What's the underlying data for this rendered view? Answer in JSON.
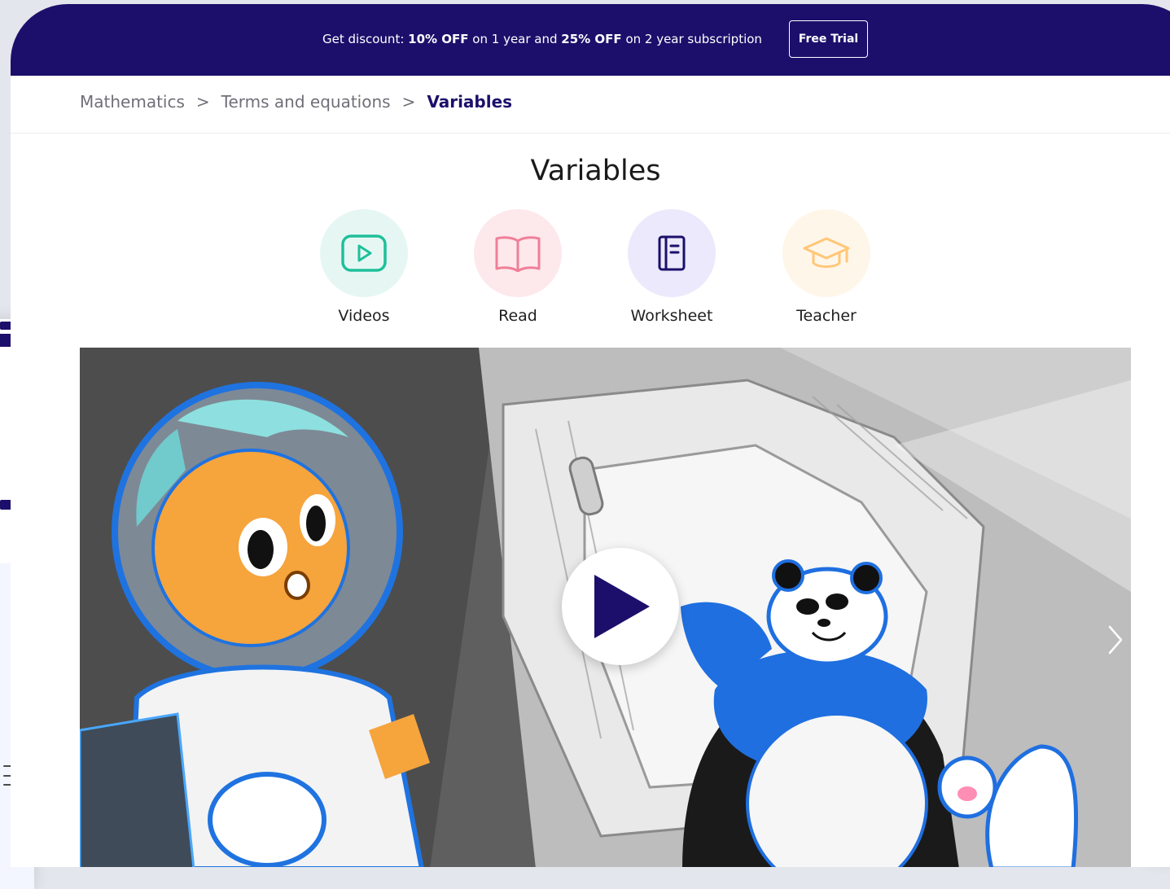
{
  "promo": {
    "prefix": "Get discount: ",
    "off1": "10% OFF",
    "mid1": " on 1 year and ",
    "off2": "25% OFF",
    "mid2": " on 2 year subscription",
    "cta": "Free Trial"
  },
  "breadcrumb": {
    "items": [
      "Mathematics",
      "Terms and equations",
      "Variables"
    ],
    "separator": ">"
  },
  "page": {
    "title": "Variables"
  },
  "tools": [
    {
      "label": "Videos",
      "icon": "video-play-icon",
      "bg": "#e6f7f3",
      "color": "#1fbf9a"
    },
    {
      "label": "Read",
      "icon": "open-book-icon",
      "bg": "#fde8ec",
      "color": "#f07f98"
    },
    {
      "label": "Worksheet",
      "icon": "notebook-icon",
      "bg": "#ebe9fb",
      "color": "#1c0f6b"
    },
    {
      "label": "Teacher",
      "icon": "graduation-cap-icon",
      "bg": "#fff6ea",
      "color": "#ffc777"
    }
  ],
  "colors": {
    "brand": "#1c0f6b",
    "panda_blue": "#1f6fe0",
    "astronaut_orange": "#f6a43c"
  }
}
